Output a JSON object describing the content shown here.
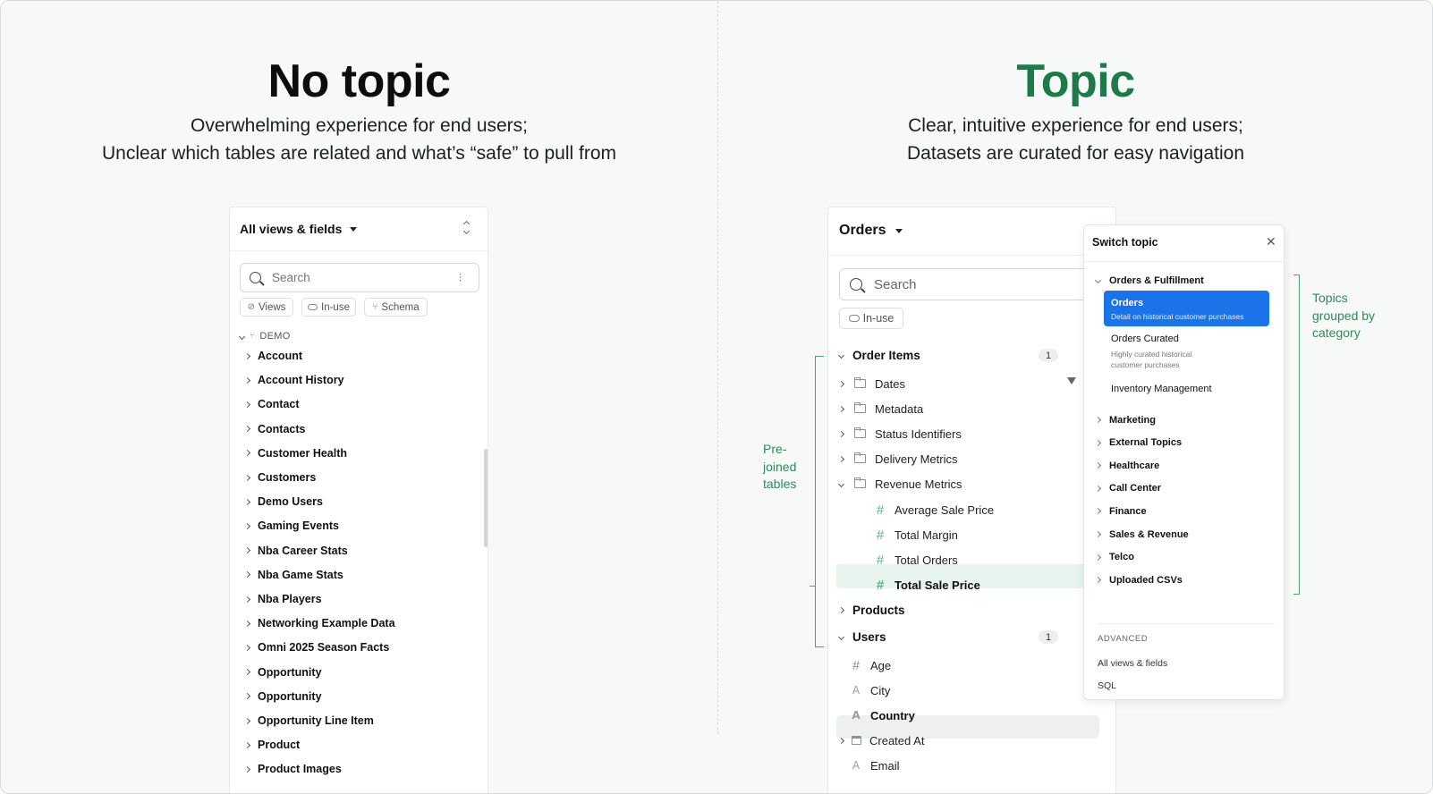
{
  "left": {
    "title": "No topic",
    "sub1": "Overwhelming experience for end users;",
    "sub2": "Unclear which tables are related and what’s “safe” to pull from",
    "panel": {
      "header": "All views & fields",
      "search_placeholder": "Search",
      "chips": [
        "Views",
        "In-use",
        "Schema"
      ],
      "section": "DEMO",
      "items": [
        "Account",
        "Account History",
        "Contact",
        "Contacts",
        "Customer Health",
        "Customers",
        "Demo Users",
        "Gaming Events",
        "Nba Career Stats",
        "Nba Game Stats",
        "Nba Players",
        "Networking Example Data",
        "Omni 2025 Season Facts",
        "Opportunity",
        "Opportunity",
        "Opportunity Line Item",
        "Product",
        "Product Images"
      ]
    }
  },
  "right": {
    "title": "Topic",
    "title_color": "#1f7a4a",
    "sub1": "Clear, intuitive experience for end users;",
    "sub2": "Datasets are curated for easy navigation",
    "panel": {
      "header": "Orders",
      "search_placeholder": "Search",
      "chip": "In-use",
      "order_items": {
        "label": "Order Items",
        "count": "1"
      },
      "folders": [
        "Dates",
        "Metadata",
        "Status Identifiers",
        "Delivery Metrics",
        "Revenue Metrics"
      ],
      "metrics": [
        "Average Sale Price",
        "Total Margin",
        "Total Orders",
        "Total Sale Price"
      ],
      "products": "Products",
      "users": {
        "label": "Users",
        "count": "1"
      },
      "user_fields": [
        "Age",
        "City",
        "Country",
        "Created At",
        "Email"
      ]
    },
    "note_prejoined": [
      "Pre-",
      "joined",
      "tables"
    ],
    "note_topics": [
      "Topics",
      "grouped by",
      "category"
    ],
    "popover": {
      "title": "Switch topic",
      "group": "Orders & Fulfillment",
      "selected": {
        "name": "Orders",
        "desc": "Detail on historical customer purchases"
      },
      "curated": {
        "name": "Orders Curated",
        "desc1": "Highly curated historical",
        "desc2": "customer purchases"
      },
      "inventory": "Inventory Management",
      "categories": [
        "Marketing",
        "External Topics",
        "Healthcare",
        "Call Center",
        "Finance",
        "Sales & Revenue",
        "Telco",
        "Uploaded CSVs"
      ],
      "advanced_label": "ADVANCED",
      "advanced": [
        "All views & fields",
        "SQL"
      ],
      "selected_color": "#1a73e8"
    }
  }
}
